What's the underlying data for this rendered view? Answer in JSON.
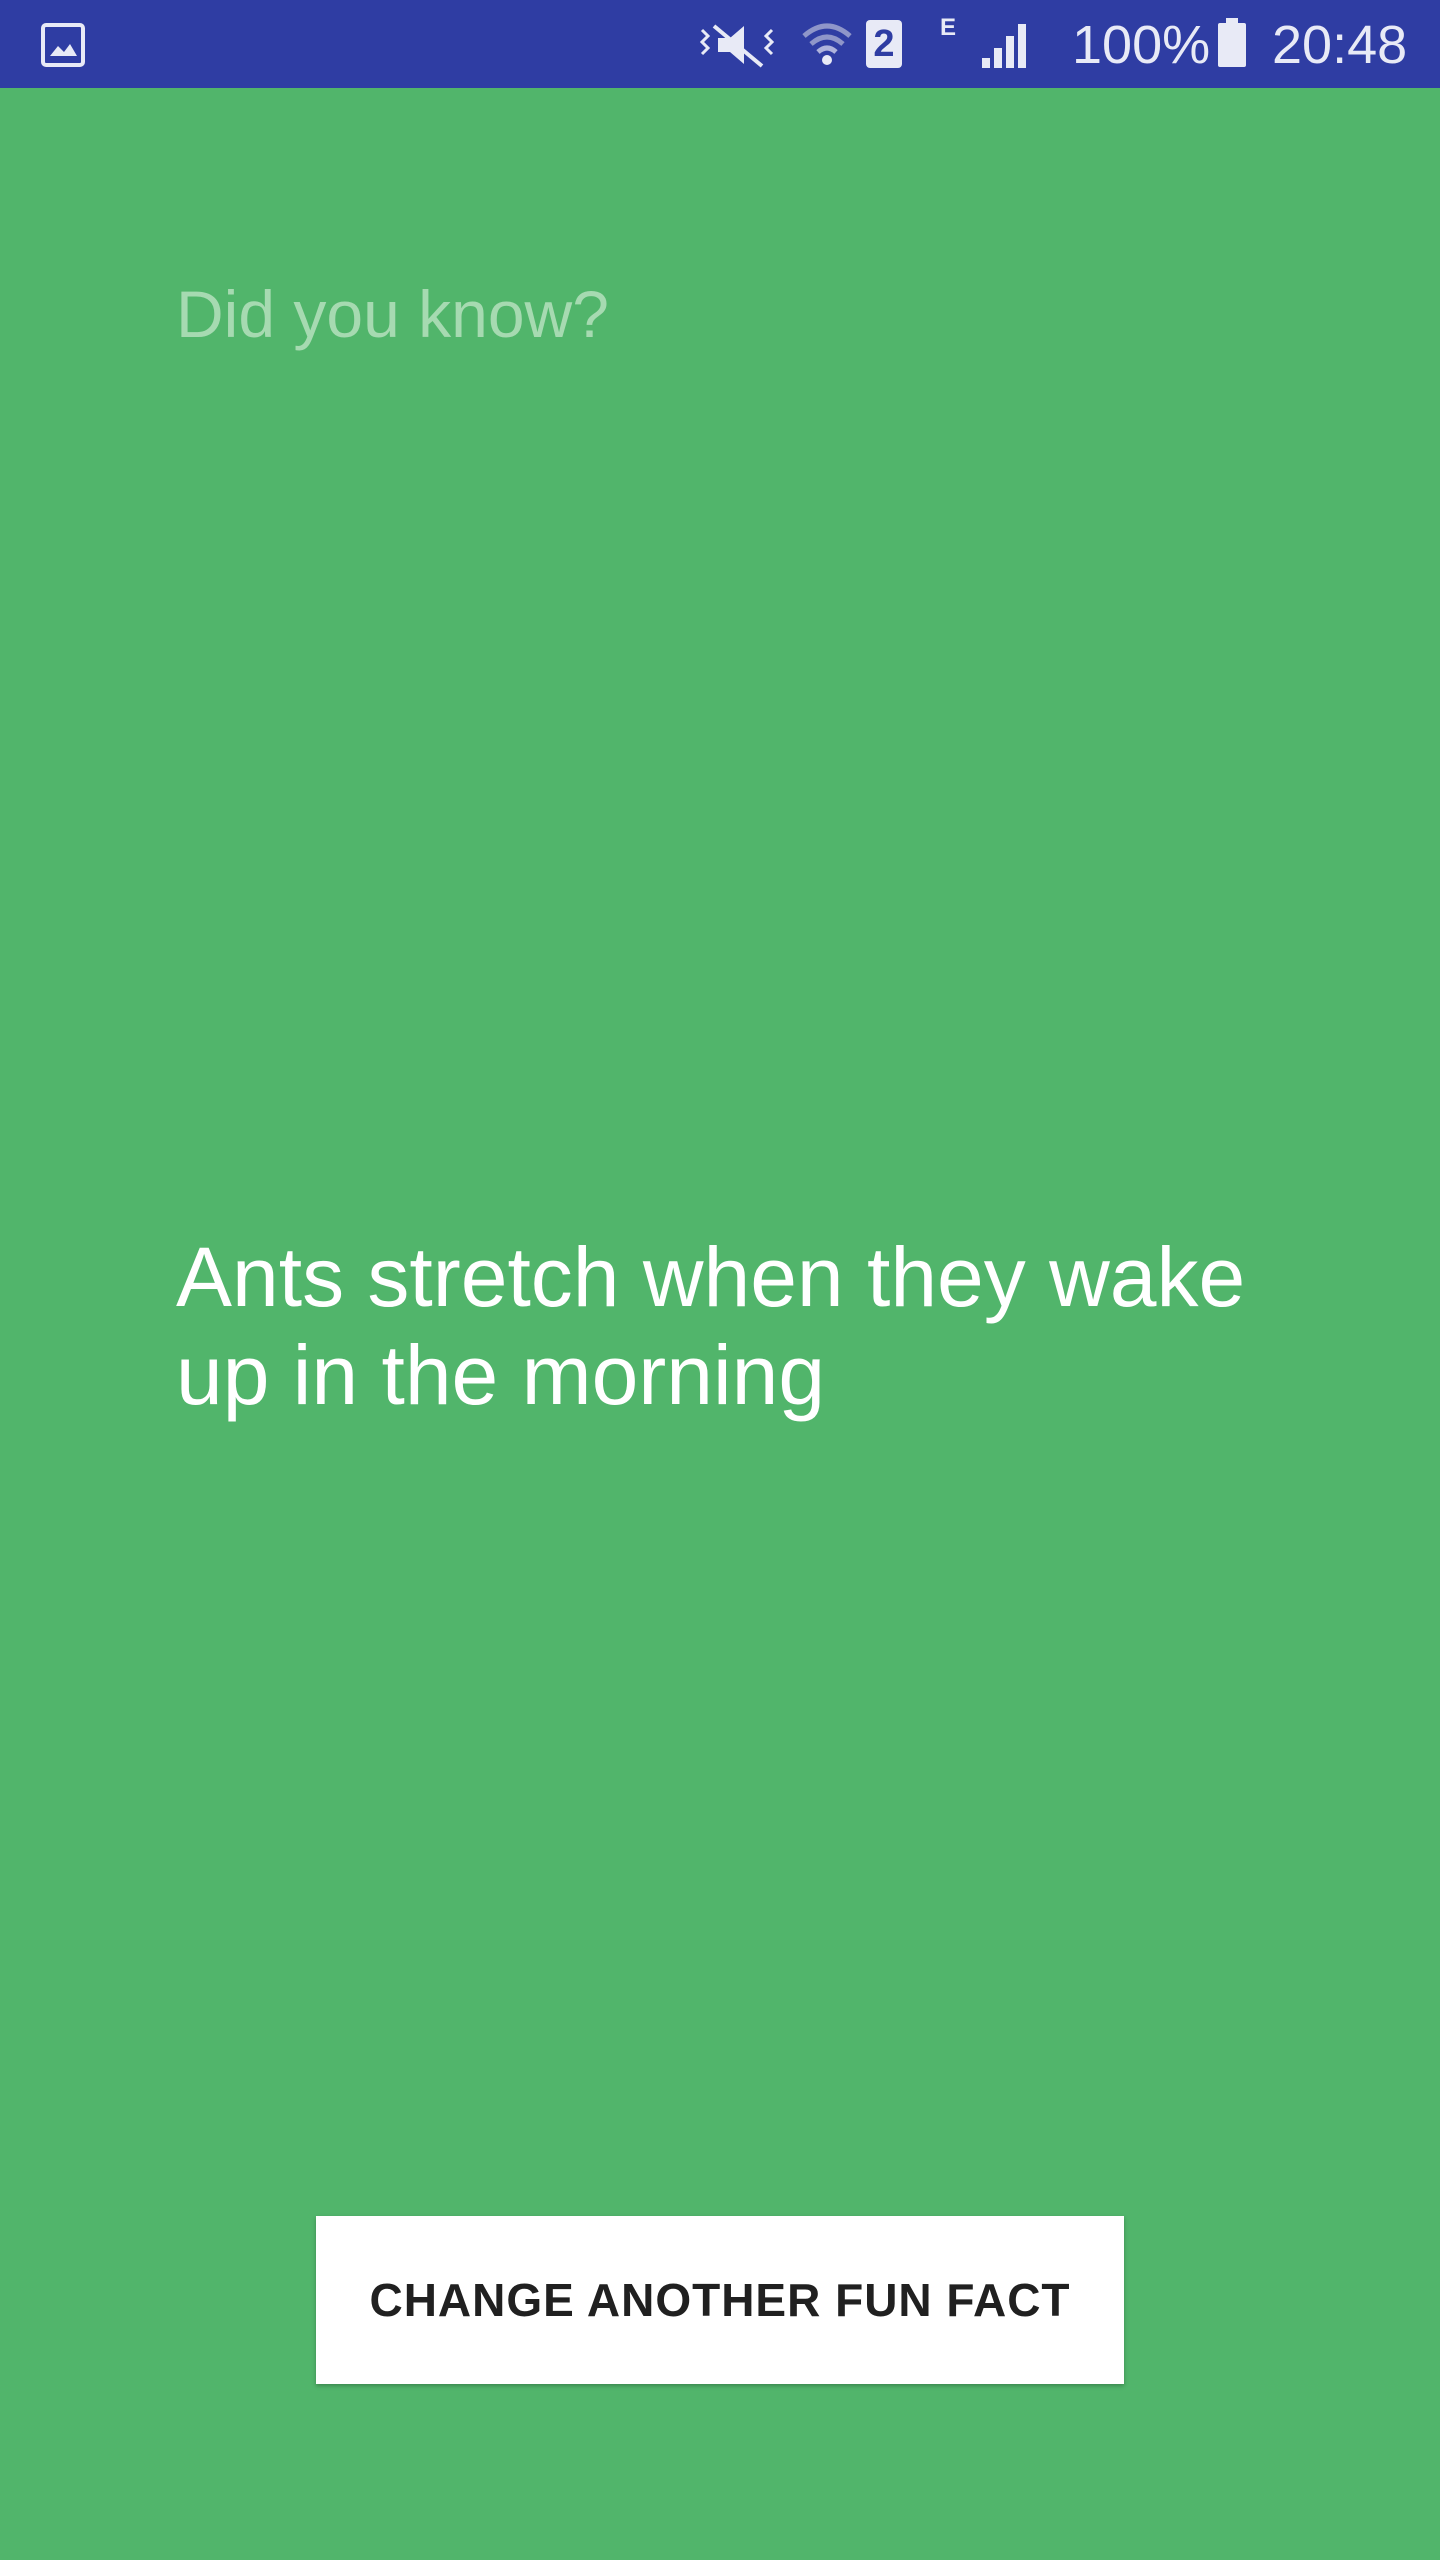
{
  "status_bar": {
    "left_icons": [
      "gallery-icon"
    ],
    "right_icons": [
      "mute-icon",
      "wifi-icon",
      "sim-icon",
      "network-type-icon",
      "signal-icon",
      "battery-icon"
    ],
    "sim_slot": "2",
    "network_type": "E",
    "battery_level": "100%",
    "time": "20:48",
    "background_color": "#2f3da3"
  },
  "main": {
    "background_color": "#51b56b",
    "title": "Did you know?",
    "fact": "Ants stretch when they wake up in the morning",
    "button_label": "CHANGE ANOTHER FUN FACT"
  }
}
